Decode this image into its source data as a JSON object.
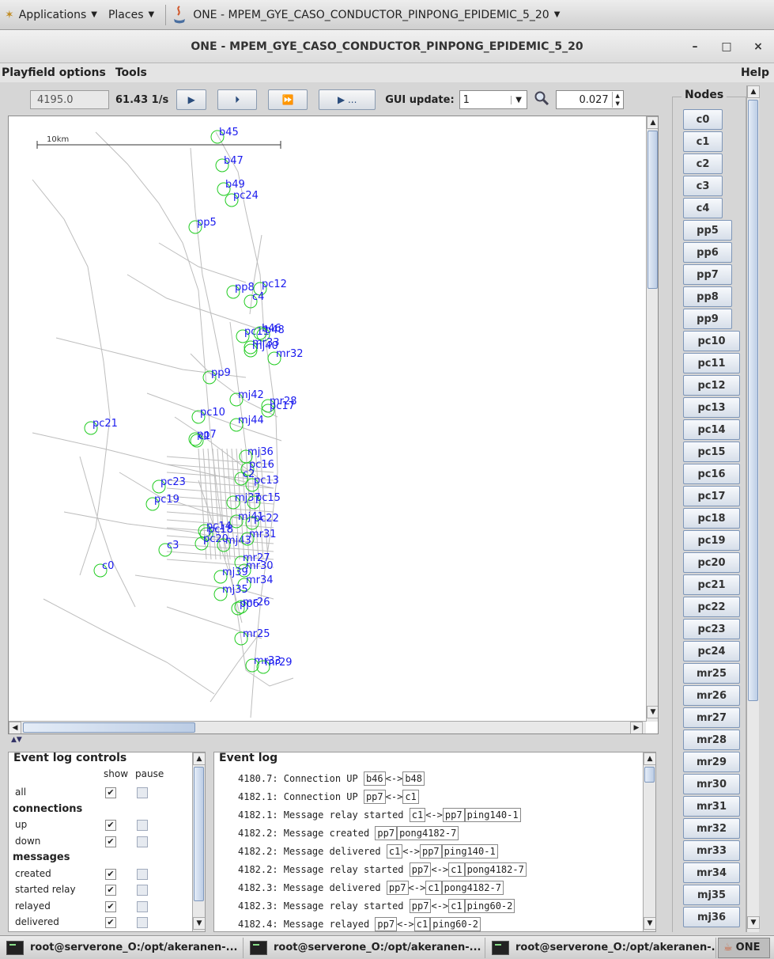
{
  "panel": {
    "applications": "Applications",
    "places": "Places",
    "window_button": "ONE - MPEM_GYE_CASO_CONDUCTOR_PINPONG_EPIDEMIC_5_20"
  },
  "window": {
    "title": "ONE - MPEM_GYE_CASO_CONDUCTOR_PINPONG_EPIDEMIC_5_20",
    "minimize": "–",
    "maximize": "□",
    "close": "×"
  },
  "menubar": {
    "playfield_options": "Playfield options",
    "tools": "Tools",
    "help": "Help"
  },
  "toolbar": {
    "sim_time": "4195.0",
    "speed": "61.43 1/s",
    "play_label": "▶",
    "step_label": "⏵",
    "ffw_label": "⏩",
    "ffw_to_label": "▶ ...",
    "gui_update_label": "GUI update:",
    "gui_update_value": "1",
    "zoom_value": "0.027"
  },
  "playfield": {
    "scale_label": "10km",
    "nodes": [
      {
        "name": "b45"
      },
      {
        "name": "b47"
      },
      {
        "name": "b49"
      },
      {
        "name": "pc24"
      },
      {
        "name": "pp5"
      },
      {
        "name": "pp8"
      },
      {
        "name": "pc12"
      },
      {
        "name": "c4"
      },
      {
        "name": "pc11"
      },
      {
        "name": "b46"
      },
      {
        "name": "b48"
      },
      {
        "name": "mr33"
      },
      {
        "name": "mj40"
      },
      {
        "name": "mr32"
      },
      {
        "name": "pp9"
      },
      {
        "name": "mj42"
      },
      {
        "name": "mr28"
      },
      {
        "name": "pc17"
      },
      {
        "name": "pc10"
      },
      {
        "name": "mj44"
      },
      {
        "name": "pc21"
      },
      {
        "name": "pp7"
      },
      {
        "name": "c1"
      },
      {
        "name": "mj36"
      },
      {
        "name": "pc16"
      },
      {
        "name": "c2"
      },
      {
        "name": "pc13"
      },
      {
        "name": "pc23"
      },
      {
        "name": "mj37"
      },
      {
        "name": "pc15"
      },
      {
        "name": "pc19"
      },
      {
        "name": "mj41"
      },
      {
        "name": "pc22"
      },
      {
        "name": "pc14"
      },
      {
        "name": "pc18"
      },
      {
        "name": "pc20"
      },
      {
        "name": "mj43"
      },
      {
        "name": "mr31"
      },
      {
        "name": "c3"
      },
      {
        "name": "mr27"
      },
      {
        "name": "mr30"
      },
      {
        "name": "c0"
      },
      {
        "name": "mj39"
      },
      {
        "name": "mr34"
      },
      {
        "name": "mj35"
      },
      {
        "name": "mr26"
      },
      {
        "name": "pp6"
      },
      {
        "name": "mr25"
      },
      {
        "name": "mr33"
      },
      {
        "name": "mr29"
      }
    ]
  },
  "event_log_controls": {
    "title": "Event log controls",
    "show": "show",
    "pause": "pause",
    "rows": [
      {
        "label": "all",
        "show": true,
        "pause": false,
        "header": false
      },
      {
        "label": "connections",
        "header": true
      },
      {
        "label": "up",
        "show": true,
        "pause": false,
        "header": false
      },
      {
        "label": "down",
        "show": true,
        "pause": false,
        "header": false
      },
      {
        "label": "messages",
        "header": true
      },
      {
        "label": "created",
        "show": true,
        "pause": false,
        "header": false
      },
      {
        "label": "started relay",
        "show": true,
        "pause": false,
        "header": false
      },
      {
        "label": "relayed",
        "show": true,
        "pause": false,
        "header": false
      },
      {
        "label": "delivered",
        "show": true,
        "pause": false,
        "header": false
      }
    ]
  },
  "event_log": {
    "title": "Event log",
    "lines": [
      {
        "time": "4180.7:",
        "text": "Connection UP",
        "parts": [
          "b46",
          "<->",
          "b48"
        ]
      },
      {
        "time": "4182.1:",
        "text": "Connection UP",
        "parts": [
          "pp7",
          "<->",
          "c1"
        ]
      },
      {
        "time": "4182.1:",
        "text": "Message relay started",
        "parts": [
          "c1",
          "<->",
          "pp7",
          "ping140-1"
        ]
      },
      {
        "time": "4182.2:",
        "text": "Message created",
        "parts": [
          "pp7",
          "pong4182-7"
        ]
      },
      {
        "time": "4182.2:",
        "text": "Message delivered",
        "parts": [
          "c1",
          "<->",
          "pp7",
          "ping140-1"
        ]
      },
      {
        "time": "4182.2:",
        "text": "Message relay started",
        "parts": [
          "pp7",
          "<->",
          "c1",
          "pong4182-7"
        ]
      },
      {
        "time": "4182.3:",
        "text": "Message delivered",
        "parts": [
          "pp7",
          "<->",
          "c1",
          "pong4182-7"
        ]
      },
      {
        "time": "4182.3:",
        "text": "Message relay started",
        "parts": [
          "pp7",
          "<->",
          "c1",
          "ping60-2"
        ]
      },
      {
        "time": "4182.4:",
        "text": "Message relayed",
        "parts": [
          "pp7",
          "<->",
          "c1",
          "ping60-2"
        ]
      }
    ]
  },
  "nodes_panel": {
    "title": "Nodes",
    "nodes": [
      "c0",
      "c1",
      "c2",
      "c3",
      "c4",
      "pp5",
      "pp6",
      "pp7",
      "pp8",
      "pp9",
      "pc10",
      "pc11",
      "pc12",
      "pc13",
      "pc14",
      "pc15",
      "pc16",
      "pc17",
      "pc18",
      "pc19",
      "pc20",
      "pc21",
      "pc22",
      "pc23",
      "pc24",
      "mr25",
      "mr26",
      "mr27",
      "mr28",
      "mr29",
      "mr30",
      "mr31",
      "mr32",
      "mr33",
      "mr34",
      "mj35",
      "mj36"
    ]
  },
  "taskbar": {
    "tasks": [
      "root@serverone_O:/opt/akeranen-...",
      "root@serverone_O:/opt/akeranen-...",
      "root@serverone_O:/opt/akeranen-...",
      "ONE"
    ]
  }
}
